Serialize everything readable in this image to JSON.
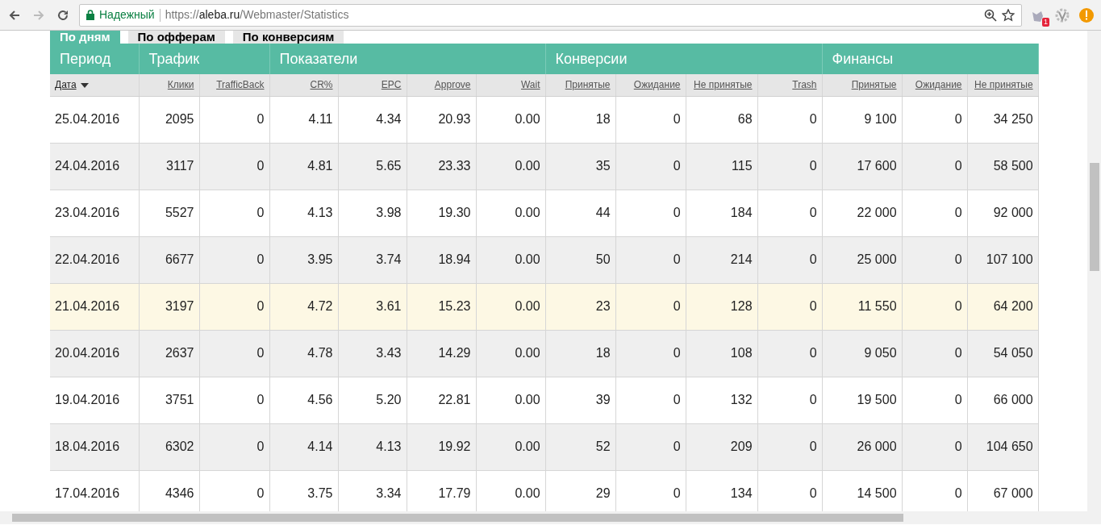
{
  "browser": {
    "security_label": "Надежный",
    "url_scheme": "https://",
    "url_host": "aleba.ru",
    "url_path": "/Webmaster/Statistics",
    "forward_disabled": true,
    "extension_badge": "1"
  },
  "tabs": [
    {
      "label": "По дням",
      "selected": true
    },
    {
      "label": "По офферам",
      "selected": false
    },
    {
      "label": "По конверсиям",
      "selected": false
    }
  ],
  "table": {
    "groups": [
      {
        "label": "Период",
        "columns": [
          {
            "label": "Дата",
            "sorted": true
          }
        ]
      },
      {
        "label": "Трафик",
        "columns": [
          {
            "label": "Клики",
            "sorted": false
          },
          {
            "label": "TrafficBack",
            "sorted": false
          }
        ]
      },
      {
        "label": "Показатели",
        "columns": [
          {
            "label": "CR%",
            "sorted": false
          },
          {
            "label": "EPC",
            "sorted": false
          },
          {
            "label": "Approve",
            "sorted": false
          },
          {
            "label": "Wait",
            "sorted": false
          }
        ]
      },
      {
        "label": "Конверсии",
        "columns": [
          {
            "label": "Принятые",
            "sorted": false
          },
          {
            "label": "Ожидание",
            "sorted": false
          },
          {
            "label": "Не принятые",
            "sorted": false
          },
          {
            "label": "Trash",
            "sorted": false
          }
        ]
      },
      {
        "label": "Финансы",
        "columns": [
          {
            "label": "Принятые",
            "sorted": false
          },
          {
            "label": "Ожидание",
            "sorted": false
          },
          {
            "label": "Не принятые",
            "sorted": false
          }
        ]
      }
    ],
    "rows": [
      {
        "highlighted": false,
        "cells": [
          "25.04.2016",
          "2095",
          "0",
          "4.11",
          "4.34",
          "20.93",
          "0.00",
          "18",
          "0",
          "68",
          "0",
          "9 100",
          "0",
          "34 250"
        ]
      },
      {
        "highlighted": false,
        "cells": [
          "24.04.2016",
          "3117",
          "0",
          "4.81",
          "5.65",
          "23.33",
          "0.00",
          "35",
          "0",
          "115",
          "0",
          "17 600",
          "0",
          "58 500"
        ]
      },
      {
        "highlighted": false,
        "cells": [
          "23.04.2016",
          "5527",
          "0",
          "4.13",
          "3.98",
          "19.30",
          "0.00",
          "44",
          "0",
          "184",
          "0",
          "22 000",
          "0",
          "92 000"
        ]
      },
      {
        "highlighted": false,
        "cells": [
          "22.04.2016",
          "6677",
          "0",
          "3.95",
          "3.74",
          "18.94",
          "0.00",
          "50",
          "0",
          "214",
          "0",
          "25 000",
          "0",
          "107 100"
        ]
      },
      {
        "highlighted": true,
        "cells": [
          "21.04.2016",
          "3197",
          "0",
          "4.72",
          "3.61",
          "15.23",
          "0.00",
          "23",
          "0",
          "128",
          "0",
          "11 550",
          "0",
          "64 200"
        ]
      },
      {
        "highlighted": false,
        "cells": [
          "20.04.2016",
          "2637",
          "0",
          "4.78",
          "3.43",
          "14.29",
          "0.00",
          "18",
          "0",
          "108",
          "0",
          "9 050",
          "0",
          "54 050"
        ]
      },
      {
        "highlighted": false,
        "cells": [
          "19.04.2016",
          "3751",
          "0",
          "4.56",
          "5.20",
          "22.81",
          "0.00",
          "39",
          "0",
          "132",
          "0",
          "19 500",
          "0",
          "66 000"
        ]
      },
      {
        "highlighted": false,
        "cells": [
          "18.04.2016",
          "6302",
          "0",
          "4.14",
          "4.13",
          "19.92",
          "0.00",
          "52",
          "0",
          "209",
          "0",
          "26 000",
          "0",
          "104 650"
        ]
      },
      {
        "highlighted": false,
        "cells": [
          "17.04.2016",
          "4346",
          "0",
          "3.75",
          "3.34",
          "17.79",
          "0.00",
          "29",
          "0",
          "134",
          "0",
          "14 500",
          "0",
          "67 000"
        ]
      }
    ]
  }
}
